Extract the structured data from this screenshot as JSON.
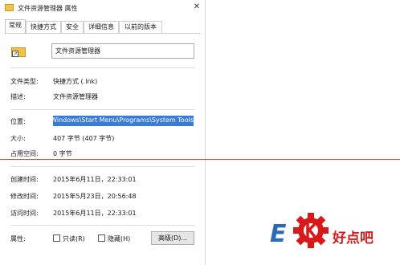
{
  "window": {
    "title": "文件资源管理器 属性",
    "close_glyph": "✕"
  },
  "tabs": [
    {
      "label": "常规",
      "active": true
    },
    {
      "label": "快捷方式"
    },
    {
      "label": "安全"
    },
    {
      "label": "详细信息"
    },
    {
      "label": "以前的版本"
    }
  ],
  "general": {
    "name_value": "文件资源管理器",
    "file_type": {
      "label": "文件类型:",
      "value": "快捷方式 (.lnk)"
    },
    "description": {
      "label": "描述:",
      "value": "文件资源管理器"
    },
    "location": {
      "label": "位置:",
      "value": "oft\\Windows\\Start Menu\\Programs\\System Tools"
    },
    "size": {
      "label": "大小:",
      "value": "407 字节 (407 字节)"
    },
    "size_on_disk": {
      "label": "占用空间:",
      "value": "0 字节"
    },
    "created": {
      "label": "创建时间:",
      "value": "2015年6月11日，22:33:01"
    },
    "modified": {
      "label": "修改时间:",
      "value": "2015年5月23日，20:56:48"
    },
    "accessed": {
      "label": "访问时间:",
      "value": "2015年6月11日，22:33:01"
    },
    "attributes": {
      "label": "属性:",
      "readonly_label": "只读(R)",
      "hidden_label": "隐藏(H)",
      "advanced_label": "高级(D)..."
    }
  },
  "watermark": {
    "brand": "好点吧",
    "icon": "gear-k-logo-icon"
  },
  "colors": {
    "selection": "#3a7bd5",
    "guide_line": "#e14040",
    "brand_red": "#d8191a",
    "brand_blue": "#2b6ab8"
  }
}
